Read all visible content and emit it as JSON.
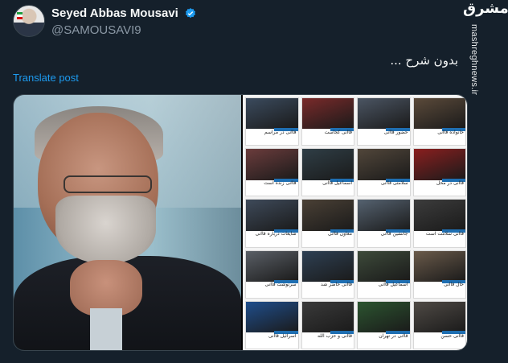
{
  "user": {
    "display_name": "Seyed Abbas Mousavi",
    "handle": "@SAMOUSAVI9",
    "verified": true,
    "avatar_icon": "profile-photo"
  },
  "watermark": {
    "logo_text": "مشرق",
    "url_text": "mashreghnews.ir"
  },
  "post": {
    "text": "بدون شرح ...",
    "translate_label": "Translate post"
  },
  "media": {
    "left_photo": "portrait-photo",
    "collage_tiles": [
      {
        "color": "#3b4b5e",
        "caption": "قاآنی در مراسم"
      },
      {
        "color": "#7a2a2a",
        "caption": "قاآنی کجاست"
      },
      {
        "color": "#4b5563",
        "caption": "حضور قاآنی"
      },
      {
        "color": "#5b4a3a",
        "caption": "خانواده قاآنی"
      },
      {
        "color": "#6b3c3c",
        "caption": "قاآنی زنده است"
      },
      {
        "color": "#2f3e46",
        "caption": "اسماعیل قاآنی"
      },
      {
        "color": "#51463a",
        "caption": "سلامتی قاآنی"
      },
      {
        "color": "#8a1f1f",
        "caption": "قاآنی در محل"
      },
      {
        "color": "#3e4a5a",
        "caption": "شایعات درباره قاآنی"
      },
      {
        "color": "#4a4035",
        "caption": "معاون قاآنی"
      },
      {
        "color": "#556270",
        "caption": "جانشین قاآنی"
      },
      {
        "color": "#3c3c3c",
        "caption": "قاآنی سلامت است"
      },
      {
        "color": "#5a5f66",
        "caption": "سرنوشت قاآنی"
      },
      {
        "color": "#2e4053",
        "caption": "قاآنی حاضر شد"
      },
      {
        "color": "#3d4a3a",
        "caption": "اسماعیل قاآنی"
      },
      {
        "color": "#6a5a4a",
        "caption": "حال قاآنی"
      },
      {
        "color": "#1f4e8c",
        "caption": "اسرائیل قاآنی"
      },
      {
        "color": "#3a3a3a",
        "caption": "قاآنی و حزب الله"
      },
      {
        "color": "#2c5530",
        "caption": "قاآنی در تهران"
      },
      {
        "color": "#4f4a45",
        "caption": "قاآنی حسن"
      }
    ]
  }
}
